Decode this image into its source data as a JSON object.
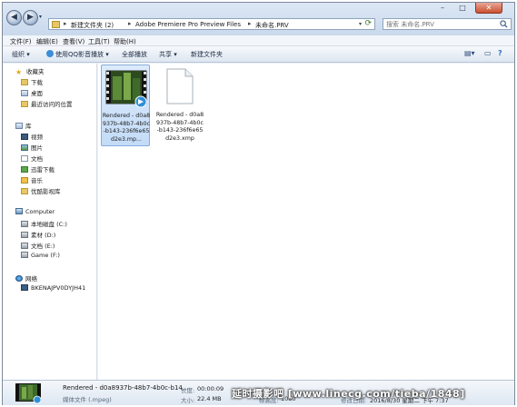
{
  "address": {
    "crumbs": [
      "新建文件夹 (2)",
      "Adobe Premiere Pro Preview Files",
      "未命名.PRV"
    ]
  },
  "search": {
    "placeholder": "搜索 未命名.PRV"
  },
  "menu": [
    "文件(F)",
    "编辑(E)",
    "查看(V)",
    "工具(T)",
    "帮助(H)"
  ],
  "toolbar": {
    "organize": "组织 ▾",
    "open_with": "使用QQ影音播放 ▾",
    "play_all": "全部播放",
    "share": "共享 ▾",
    "new_folder": "新建文件夹"
  },
  "nav": {
    "favorites": "收藏夹",
    "downloads": "下载",
    "desktop": "桌面",
    "recent": "最近访问的位置",
    "libraries": "库",
    "videos": "视频",
    "pictures": "图片",
    "documents": "文档",
    "xunlei": "迅雷下载",
    "music": "音乐",
    "youku": "优酷影视库",
    "computer": "Computer",
    "drive_c": "本地磁盘 (C:)",
    "drive_d": "素材 (D:)",
    "drive_e": "文档 (E:)",
    "drive_f": "Game (F:)",
    "network": "网络",
    "pc_name": "BKENAJPV0DYJH41"
  },
  "files": [
    {
      "name": "Rendered - d0a8937b-48b7-4b0c-b143-236f6e65d2e3.mp...",
      "type": "video",
      "selected": true
    },
    {
      "name": "Rendered - d0a8937b-48b7-4b0c-b143-236f6e65d2e3.xmp",
      "type": "document",
      "selected": false
    }
  ],
  "details": {
    "title": "Rendered - d0a8937b-48b7-4b0c-b14...",
    "type": "媒体文件 (.mpeg)",
    "length_label": "长度:",
    "length": "00:00:09",
    "size_label": "大小:",
    "size": "22.4 MB",
    "height_label": "帧高度:",
    "height": "1080",
    "modified_label": "修改日期:",
    "modified": "2016/8/30 星期二 下午 7:37"
  },
  "watermark": "延时摄影吧 [www.linecg.com/tieba/1848]",
  "colors": {
    "selection": "#c4dcf8",
    "chrome": "#dce7f4",
    "folder": "#e7c765"
  }
}
